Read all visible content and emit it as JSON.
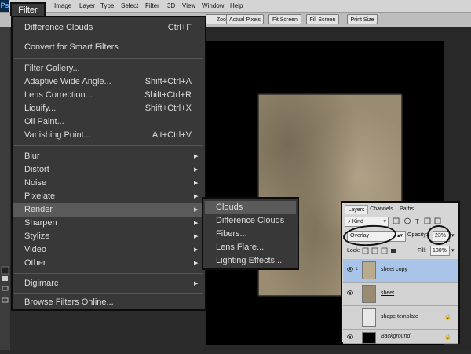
{
  "menubar": {
    "items": [
      "Image",
      "Layer",
      "Type",
      "Select",
      "Filter",
      "3D",
      "View",
      "Window",
      "Help"
    ],
    "filter_tab": "Filter"
  },
  "options_bar": {
    "buttons": [
      "Zoom All Windows",
      "Actual Pixels",
      "Fit Screen",
      "Fill Screen",
      "Print Size"
    ]
  },
  "filter_menu": {
    "items": [
      {
        "label": "Difference Clouds",
        "shortcut": "Ctrl+F"
      },
      {
        "label": "Convert for Smart Filters",
        "shortcut": ""
      },
      {
        "label": "Filter Gallery...",
        "shortcut": ""
      },
      {
        "label": "Adaptive Wide Angle...",
        "shortcut": "Shift+Ctrl+A"
      },
      {
        "label": "Lens Correction...",
        "shortcut": "Shift+Ctrl+R"
      },
      {
        "label": "Liquify...",
        "shortcut": "Shift+Ctrl+X"
      },
      {
        "label": "Oil Paint...",
        "shortcut": ""
      },
      {
        "label": "Vanishing Point...",
        "shortcut": "Alt+Ctrl+V"
      },
      {
        "label": "Blur",
        "shortcut": "",
        "submenu": true
      },
      {
        "label": "Distort",
        "shortcut": "",
        "submenu": true
      },
      {
        "label": "Noise",
        "shortcut": "",
        "submenu": true
      },
      {
        "label": "Pixelate",
        "shortcut": "",
        "submenu": true
      },
      {
        "label": "Render",
        "shortcut": "",
        "submenu": true,
        "highlighted": true
      },
      {
        "label": "Sharpen",
        "shortcut": "",
        "submenu": true
      },
      {
        "label": "Stylize",
        "shortcut": "",
        "submenu": true
      },
      {
        "label": "Video",
        "shortcut": "",
        "submenu": true
      },
      {
        "label": "Other",
        "shortcut": "",
        "submenu": true
      },
      {
        "label": "Digimarc",
        "shortcut": "",
        "submenu": true
      },
      {
        "label": "Browse Filters Online...",
        "shortcut": ""
      }
    ]
  },
  "render_submenu": {
    "items": [
      "Clouds",
      "Difference Clouds",
      "Fibers...",
      "Lens Flare...",
      "Lighting Effects..."
    ],
    "highlighted": "Clouds"
  },
  "layers_panel": {
    "tabs": [
      "Layers",
      "Channels",
      "Paths"
    ],
    "active_tab": "Layers",
    "kind_label": "Kind",
    "blend_mode": "Overlay",
    "opacity_label": "Opacity:",
    "opacity_value": "23%",
    "lock_label": "Lock:",
    "fill_label": "Fill:",
    "fill_value": "100%",
    "layers": [
      {
        "name": "sheet copy",
        "selected": true,
        "visible": true,
        "locked": false
      },
      {
        "name": "sheet",
        "selected": false,
        "visible": true,
        "locked": false
      },
      {
        "name": "shape template",
        "selected": false,
        "visible": false,
        "locked": true
      },
      {
        "name": "Background",
        "selected": false,
        "visible": true,
        "locked": true
      }
    ]
  },
  "colors": {
    "menu_bg": "#383838",
    "menu_highlight": "#5a5a5a",
    "selected_layer": "#a8c4e8",
    "paper": "#9a8c72"
  }
}
